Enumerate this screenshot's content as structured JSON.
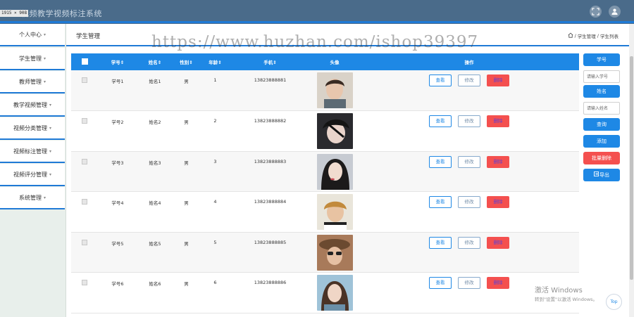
{
  "topbar": {
    "title": "视频教学视频标注系统",
    "resolution_tag": "1915 × 908"
  },
  "sidebar": {
    "items": [
      {
        "label": "个人中心",
        "caret": "▾"
      },
      {
        "label": "学生管理",
        "caret": "▾"
      },
      {
        "label": "教师管理",
        "caret": "▾"
      },
      {
        "label": "教学视频管理",
        "caret": "▾"
      },
      {
        "label": "视频分类管理",
        "caret": "▾"
      },
      {
        "label": "视频标注管理",
        "caret": "▾"
      },
      {
        "label": "视频评分管理",
        "caret": "▾"
      },
      {
        "label": "系统管理",
        "caret": "▾"
      }
    ]
  },
  "header": {
    "page_title": "学生管理",
    "watermark": "https://www.huzhan.com/ishop39397",
    "breadcrumb": {
      "sep": "/",
      "item1": "学生管理",
      "item2": "学生列表"
    }
  },
  "table": {
    "columns": [
      "学号⇕",
      "姓名⇕",
      "性别⇕",
      "年龄⇕",
      "手机⇕",
      "头像",
      "操作"
    ],
    "rows": [
      {
        "id": "学号1",
        "name": "姓名1",
        "gender": "男",
        "age": "1",
        "phone": "13823888881"
      },
      {
        "id": "学号2",
        "name": "姓名2",
        "gender": "男",
        "age": "2",
        "phone": "13823888882"
      },
      {
        "id": "学号3",
        "name": "姓名3",
        "gender": "男",
        "age": "3",
        "phone": "13823888883"
      },
      {
        "id": "学号4",
        "name": "姓名4",
        "gender": "男",
        "age": "4",
        "phone": "13823888884"
      },
      {
        "id": "学号5",
        "name": "姓名5",
        "gender": "男",
        "age": "5",
        "phone": "13823888885"
      },
      {
        "id": "学号6",
        "name": "姓名6",
        "gender": "男",
        "age": "6",
        "phone": "13823888886"
      }
    ],
    "actions": {
      "view": "查看",
      "edit": "修改",
      "delete": "删除"
    }
  },
  "right_panel": {
    "id_label": "学号",
    "id_placeholder": "请输入学号",
    "name_label": "姓名",
    "name_placeholder": "请输入姓名",
    "search": "查询",
    "add": "添加",
    "batch_delete": "批量删除",
    "export": "导出"
  },
  "overlay": {
    "activate_title": "激活 Windows",
    "activate_sub": "转到\"设置\"以激活 Windows。",
    "top_button": "Top"
  },
  "colors": {
    "accent": "#1e88e5",
    "danger": "#f4504f",
    "topbar": "#4a6b8a",
    "sidebar_bg": "#e8efeb"
  }
}
